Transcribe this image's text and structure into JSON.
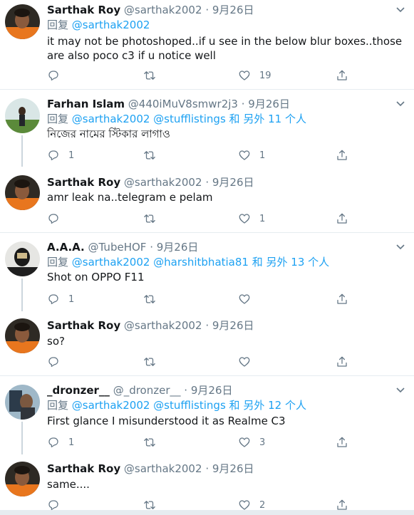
{
  "tweets": [
    {
      "name": "Sarthak Roy",
      "handle": "@sarthak2002",
      "sep": "·",
      "time": "9月26日",
      "reply_prefix": "回复",
      "mentions": "@sarthak2002",
      "reply_suffix": "",
      "text": "it may not be photoshoped..if u see in the below blur boxes..those are also poco c3 if u notice well",
      "reply_count": "",
      "retweet_count": "",
      "like_count": "19"
    },
    {
      "name": "Farhan Islam",
      "handle": "@440iMuV8smwr2j3",
      "sep": "·",
      "time": "9月26日",
      "reply_prefix": "回复",
      "mentions": "@sarthak2002 @stufflistings",
      "reply_suffix": "和 另外 11 个人",
      "text": "নিজের নামের স্টিকার লাগাও",
      "reply_count": "1",
      "retweet_count": "",
      "like_count": "1"
    },
    {
      "name": "Sarthak Roy",
      "handle": "@sarthak2002",
      "sep": "·",
      "time": "9月26日",
      "text": "amr leak na..telegram e pelam",
      "reply_count": "",
      "retweet_count": "",
      "like_count": "1"
    },
    {
      "name": "A.A.A.",
      "handle": "@TubeHOF",
      "sep": "·",
      "time": "9月26日",
      "reply_prefix": "回复",
      "mentions": "@sarthak2002 @harshitbhatia81",
      "reply_suffix": "和 另外 13 个人",
      "text": "Shot on OPPO F11",
      "reply_count": "1",
      "retweet_count": "",
      "like_count": ""
    },
    {
      "name": "Sarthak Roy",
      "handle": "@sarthak2002",
      "sep": "·",
      "time": "9月26日",
      "text": "so?",
      "reply_count": "",
      "retweet_count": "",
      "like_count": ""
    },
    {
      "name": "_dronzer__",
      "handle": "@_dronzer__",
      "sep": "·",
      "time": "9月26日",
      "reply_prefix": "回复",
      "mentions": "@sarthak2002 @stufflistings",
      "reply_suffix": "和 另外 12 个人",
      "text": "First glance I misunderstood it as Realme C3",
      "reply_count": "1",
      "retweet_count": "",
      "like_count": "3"
    },
    {
      "name": "Sarthak Roy",
      "handle": "@sarthak2002",
      "sep": "·",
      "time": "9月26日",
      "text": "same....",
      "reply_count": "",
      "retweet_count": "",
      "like_count": "2"
    }
  ],
  "colors": {
    "accent": "#1da1f2",
    "muted": "#657786",
    "text": "#14171a",
    "divider": "#e6ecf0",
    "thread_line": "#ccd6dd"
  },
  "icons": {
    "reply": "reply-icon",
    "retweet": "retweet-icon",
    "like": "like-icon",
    "share": "share-icon",
    "more": "chevron-down-icon"
  }
}
